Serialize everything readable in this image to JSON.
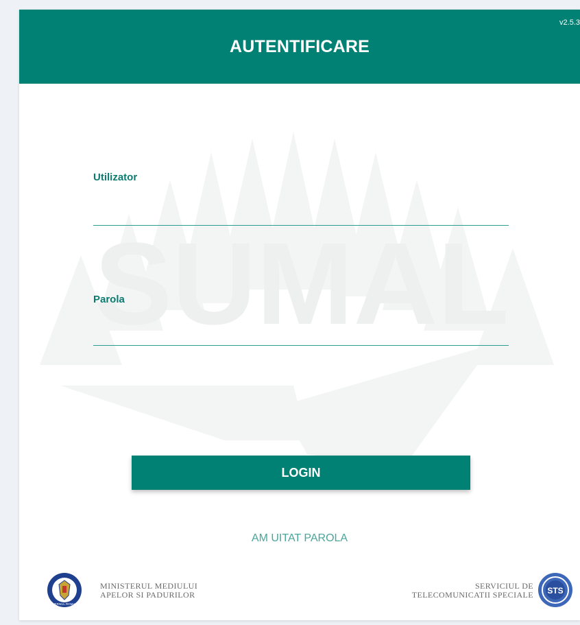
{
  "header": {
    "title": "AUTENTIFICARE",
    "version": "v2.5.3"
  },
  "watermark": {
    "text": "SUMAL"
  },
  "form": {
    "username_label": "Utilizator",
    "username_value": "",
    "password_label": "Parola",
    "password_value": "",
    "login_label": "LOGIN",
    "forgot_password_label": "AM UITAT PAROLA"
  },
  "footer": {
    "left_line1": "MINISTERUL MEDIULUI",
    "left_line2": "APELOR SI PADURILOR",
    "left_emblem_text": "GUVERNUL ROMANIEI",
    "right_line1": "SERVICIUL DE",
    "right_line2": "TELECOMUNICATII SPECIALE",
    "right_emblem_text": "STS"
  },
  "colors": {
    "primary": "#018174",
    "label": "#0b7b6f",
    "link": "#4aa59a",
    "emblem_blue": "#1f3f8f"
  }
}
